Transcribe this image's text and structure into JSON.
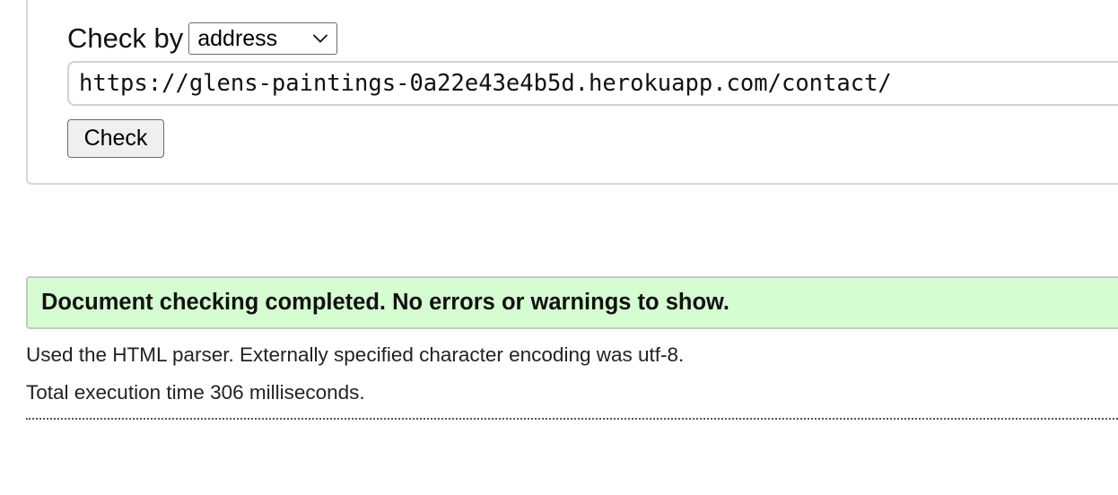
{
  "check_form": {
    "check_by_label": "Check by",
    "check_by_select": {
      "selected": "address",
      "icon": "chevron-down-icon"
    },
    "url_value": "https://glens-paintings-0a22e43e4b5d.herokuapp.com/contact/",
    "check_button_label": "Check"
  },
  "results": {
    "success_message": "Document checking completed. No errors or warnings to show.",
    "success_color": "#d6fcd2",
    "parser_info": "Used the HTML parser. Externally specified character encoding was utf-8.",
    "execution_time": "Total execution time 306 milliseconds."
  }
}
